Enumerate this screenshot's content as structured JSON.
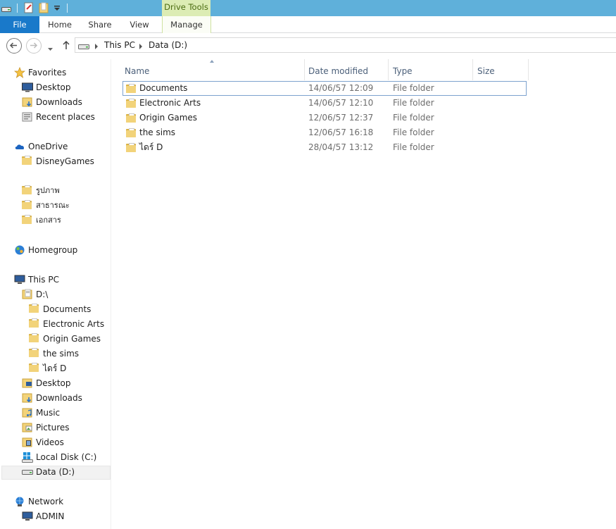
{
  "ribbon": {
    "contextual_group": "Drive Tools",
    "tabs": [
      {
        "label": "File"
      },
      {
        "label": "Home"
      },
      {
        "label": "Share"
      },
      {
        "label": "View"
      },
      {
        "label": "Manage"
      }
    ]
  },
  "address": {
    "breadcrumb": [
      "This PC",
      "Data (D:)"
    ]
  },
  "nav": {
    "favorites": {
      "label": "Favorites",
      "items": [
        "Desktop",
        "Downloads",
        "Recent places"
      ]
    },
    "onedrive": {
      "label": "OneDrive",
      "items": [
        "DisneyGames"
      ]
    },
    "libraries": [
      "รูปภาพ",
      "สาธารณะ",
      "เอกสาร"
    ],
    "homegroup": "Homegroup",
    "thispc": {
      "label": "This PC",
      "drive_d": "D:\\",
      "drive_d_children": [
        "Documents",
        "Electronic Arts",
        "Origin Games",
        "the sims",
        "ไดร์ D"
      ],
      "items": [
        "Desktop",
        "Downloads",
        "Music",
        "Pictures",
        "Videos",
        "Local Disk (C:)",
        "Data (D:)"
      ]
    },
    "network": {
      "label": "Network",
      "items": [
        "ADMIN"
      ]
    }
  },
  "columns": [
    "Name",
    "Date modified",
    "Type",
    "Size"
  ],
  "files": [
    {
      "name": "Documents",
      "date": "14/06/57 12:09",
      "type": "File folder",
      "size": ""
    },
    {
      "name": "Electronic Arts",
      "date": "14/06/57 12:10",
      "type": "File folder",
      "size": ""
    },
    {
      "name": "Origin Games",
      "date": "12/06/57 12:37",
      "type": "File folder",
      "size": ""
    },
    {
      "name": "the sims",
      "date": "12/06/57 16:18",
      "type": "File folder",
      "size": ""
    },
    {
      "name": "ไดร์ D",
      "date": "28/04/57 13:12",
      "type": "File folder",
      "size": ""
    }
  ],
  "colors": {
    "titlebar": "#5fb0da",
    "file_tab": "#1979ca",
    "contextual": "#dcecb4",
    "selection_border": "#7da2ce",
    "folder": "#f2d37a"
  }
}
